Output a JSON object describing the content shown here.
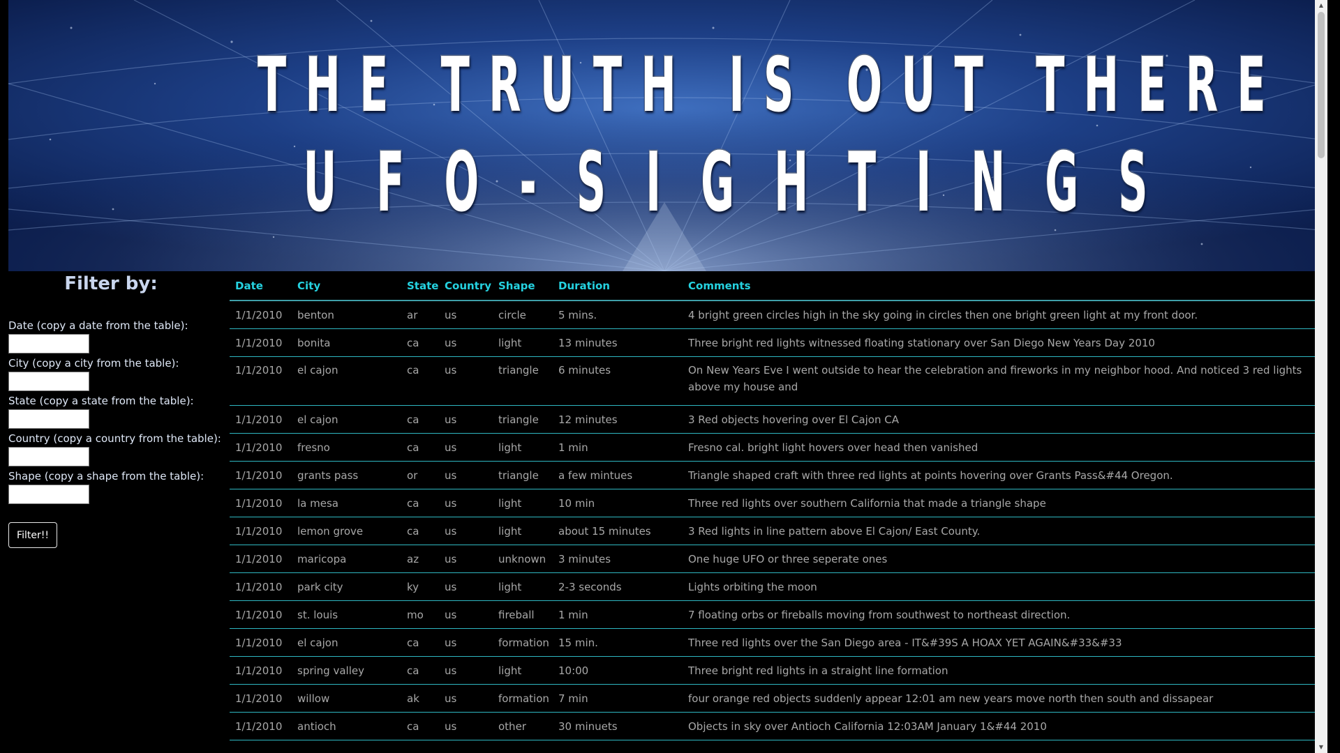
{
  "banner": {
    "line1": "THE TRUTH IS OUT THERE",
    "line2": "UFO-SIGHTINGS"
  },
  "sidebar": {
    "heading": "Filter by:",
    "filters": [
      {
        "label": "Date (copy a date from the table):",
        "value": "",
        "placeholder": ""
      },
      {
        "label": "City (copy a city from the table):",
        "value": "",
        "placeholder": ""
      },
      {
        "label": "State (copy a state from the table):",
        "value": "",
        "placeholder": ""
      },
      {
        "label": "Country (copy a country from the table):",
        "value": "",
        "placeholder": ""
      },
      {
        "label": "Shape (copy a shape from the table):",
        "value": "",
        "placeholder": ""
      }
    ],
    "button_label": "Filter!!"
  },
  "table": {
    "headers": [
      "Date",
      "City",
      "State",
      "Country",
      "Shape",
      "Duration",
      "Comments"
    ],
    "rows": [
      [
        "1/1/2010",
        "benton",
        "ar",
        "us",
        "circle",
        "5 mins.",
        "4 bright green circles high in the sky going in circles then one bright green light at my front door."
      ],
      [
        "1/1/2010",
        "bonita",
        "ca",
        "us",
        "light",
        "13 minutes",
        "Three bright red lights witnessed floating stationary over San Diego New Years Day 2010"
      ],
      [
        "1/1/2010",
        "el cajon",
        "ca",
        "us",
        "triangle",
        "6 minutes",
        "On New Years Eve I went outside to hear the celebration and fireworks in my neighbor hood. And noticed 3 red lights above my house and"
      ],
      [
        "1/1/2010",
        "el cajon",
        "ca",
        "us",
        "triangle",
        "12 minutes",
        "3 Red objects hovering over El Cajon CA"
      ],
      [
        "1/1/2010",
        "fresno",
        "ca",
        "us",
        "light",
        "1 min",
        "Fresno cal. bright light hovers over head then vanished"
      ],
      [
        "1/1/2010",
        "grants pass",
        "or",
        "us",
        "triangle",
        "a few mintues",
        "Triangle shaped craft with three red lights at points hovering over Grants Pass&#44 Oregon."
      ],
      [
        "1/1/2010",
        "la mesa",
        "ca",
        "us",
        "light",
        "10 min",
        "Three red lights over southern California that made a triangle shape"
      ],
      [
        "1/1/2010",
        "lemon grove",
        "ca",
        "us",
        "light",
        "about 15 minutes",
        "3 Red lights in line pattern above El Cajon/ East County."
      ],
      [
        "1/1/2010",
        "maricopa",
        "az",
        "us",
        "unknown",
        "3 minutes",
        "One huge UFO or three seperate ones"
      ],
      [
        "1/1/2010",
        "park city",
        "ky",
        "us",
        "light",
        "2-3 seconds",
        "Lights orbiting the moon"
      ],
      [
        "1/1/2010",
        "st. louis",
        "mo",
        "us",
        "fireball",
        "1 min",
        "7 floating orbs or fireballs moving from southwest to northeast direction."
      ],
      [
        "1/1/2010",
        "el cajon",
        "ca",
        "us",
        "formation",
        "15 min.",
        "Three red lights over the San Diego area - IT&#39S A HOAX YET AGAIN&#33&#33"
      ],
      [
        "1/1/2010",
        "spring valley",
        "ca",
        "us",
        "light",
        "10:00",
        "Three bright red lights in a straight line formation"
      ],
      [
        "1/1/2010",
        "willow",
        "ak",
        "us",
        "formation",
        "7 min",
        "four orange red objects suddenly appear 12:01 am new years move north then south and dissapear"
      ],
      [
        "1/1/2010",
        "antioch",
        "ca",
        "us",
        "other",
        "30 minuets",
        "Objects in sky over Antioch California 12:03AM January 1&#44 2010"
      ]
    ]
  },
  "colors": {
    "background": "#000000",
    "header_text": "#25d2e0",
    "row_text": "#a8a8a8",
    "row_divider": "#2fb8c2",
    "banner_blue": "#1d3f86"
  }
}
